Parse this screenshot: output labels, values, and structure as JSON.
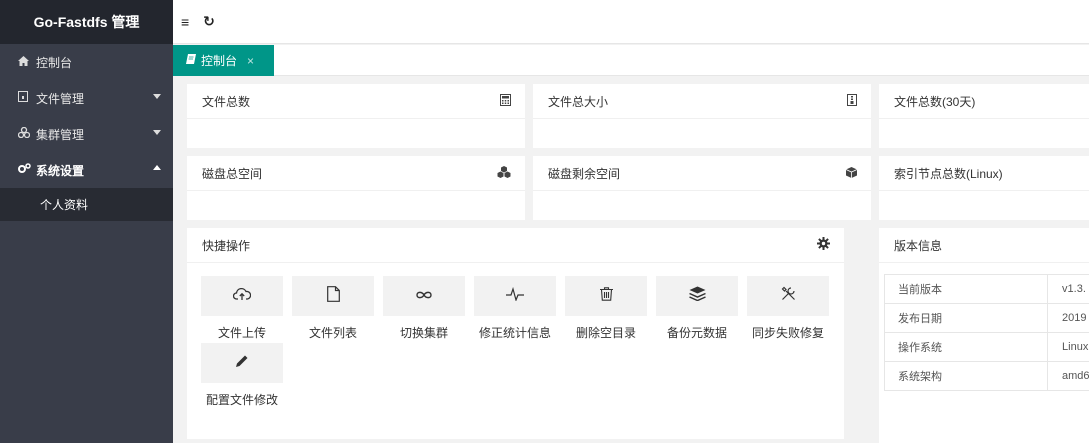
{
  "app": {
    "title": "Go-Fastdfs 管理"
  },
  "sidebar": {
    "items": [
      {
        "label": "控制台",
        "icon": "home-icon"
      },
      {
        "label": "文件管理",
        "icon": "file-icon",
        "expanded": false
      },
      {
        "label": "集群管理",
        "icon": "cluster-icon",
        "expanded": false
      },
      {
        "label": "系统设置",
        "icon": "gears-icon",
        "expanded": true
      }
    ],
    "sub_items": [
      {
        "label": "个人资料"
      }
    ]
  },
  "topbar": {
    "menu_icon": "≡",
    "refresh_icon": "↻"
  },
  "tabs": [
    {
      "label": "控制台",
      "icon": "notebook-icon",
      "close": "×"
    }
  ],
  "stats": [
    {
      "label": "文件总数",
      "icon": "calculator-icon",
      "value": ""
    },
    {
      "label": "文件总大小",
      "icon": "file-archive-icon",
      "value": ""
    },
    {
      "label": "文件总数(30天)",
      "icon": "",
      "value": ""
    },
    {
      "label": "磁盘总空间",
      "icon": "cubes-icon",
      "value": ""
    },
    {
      "label": "磁盘剩余空间",
      "icon": "cube-icon",
      "value": ""
    },
    {
      "label": "索引节点总数(Linux)",
      "icon": "",
      "value": ""
    }
  ],
  "quick_actions": {
    "title": "快捷操作",
    "settings_icon": "gear-icon",
    "items": [
      {
        "label": "文件上传",
        "icon": "cloud-upload-icon"
      },
      {
        "label": "文件列表",
        "icon": "file-outline-icon"
      },
      {
        "label": "切换集群",
        "icon": "infinity-icon"
      },
      {
        "label": "修正统计信息",
        "icon": "pulse-icon"
      },
      {
        "label": "删除空目录",
        "icon": "trash-icon"
      },
      {
        "label": "备份元数据",
        "icon": "layers-icon"
      },
      {
        "label": "同步失败修复",
        "icon": "tools-icon"
      },
      {
        "label": "配置文件修改",
        "icon": "pencil-icon"
      }
    ]
  },
  "version_info": {
    "title": "版本信息",
    "rows": [
      {
        "key": "当前版本",
        "value": "v1.3."
      },
      {
        "key": "发布日期",
        "value": "2019"
      },
      {
        "key": "操作系统",
        "value": "Linux"
      },
      {
        "key": "系统架构",
        "value": "amd6"
      }
    ]
  },
  "colors": {
    "sidebar": "#393d49",
    "logo": "#23262e",
    "accent": "#009688",
    "submenu": "#282b33"
  }
}
